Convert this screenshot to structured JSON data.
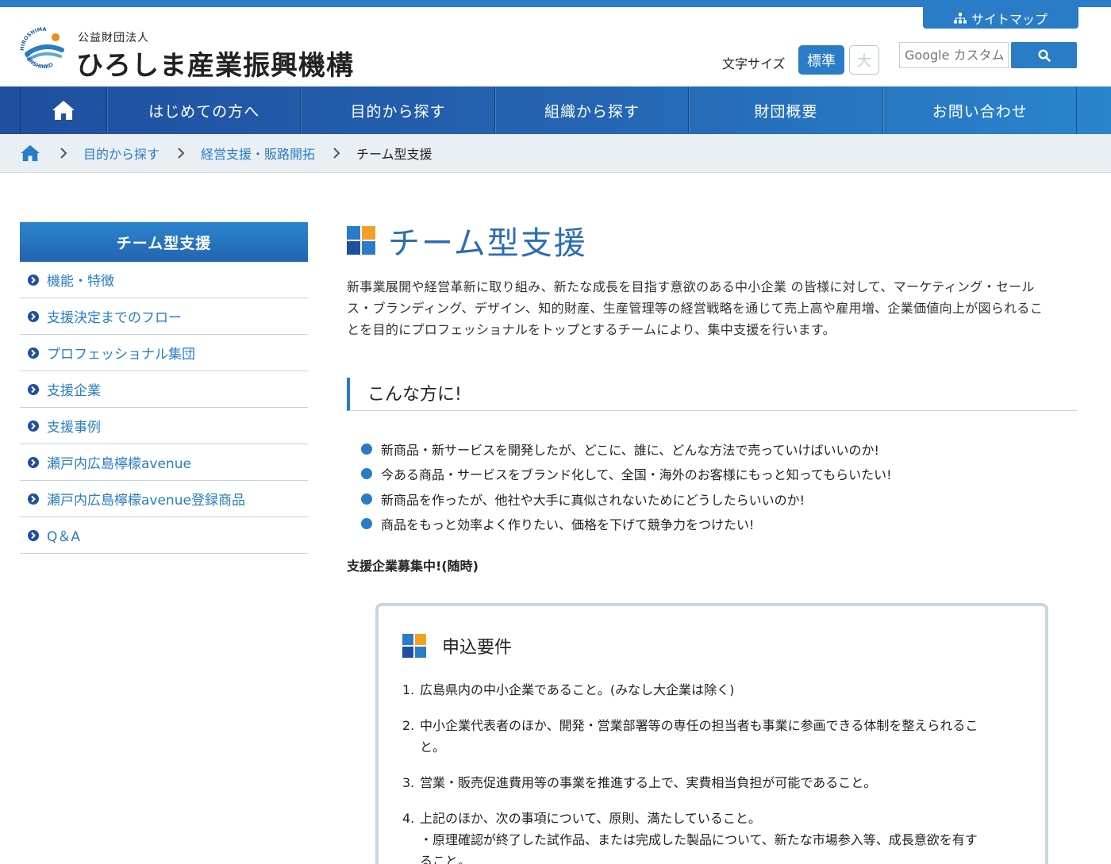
{
  "header": {
    "org_type": "公益財団法人",
    "org_name": "ひろしま産業振興機構",
    "logo_ring_text_top": "HIROSHIMA",
    "logo_ring_text_bottom": "SANSHINKO",
    "sitemap_label": "サイトマップ",
    "font_size_label": "文字サイズ",
    "font_size_standard": "標準",
    "font_size_large": "大",
    "search_placeholder": "Google カスタム検索"
  },
  "nav": {
    "items": [
      {
        "label": "はじめての方へ"
      },
      {
        "label": "目的から探す"
      },
      {
        "label": "組織から探す"
      },
      {
        "label": "財団概要"
      },
      {
        "label": "お問い合わせ"
      }
    ]
  },
  "breadcrumb": {
    "items": [
      "目的から探す",
      "経営支援・販路開拓"
    ],
    "current": "チーム型支援"
  },
  "sidebar": {
    "title": "チーム型支援",
    "items": [
      {
        "label": "機能・特徴"
      },
      {
        "label": "支援決定までのフロー"
      },
      {
        "label": "プロフェッショナル集団"
      },
      {
        "label": "支援企業"
      },
      {
        "label": "支援事例"
      },
      {
        "label": "瀬戸内広島檸檬avenue"
      },
      {
        "label": "瀬戸内広島檸檬avenue登録商品"
      },
      {
        "label": "Q＆A"
      }
    ]
  },
  "main": {
    "title": "チーム型支援",
    "intro_lines": [
      "新事業展開や経営革新に取り組み、新たな成長を目指す意欲のある中小企業 の皆様に対して、マーケティング・セール",
      "ス・ブランディング、デザイン、知的財産、生産管理等の経営戦略を通じて売上高や雇用増、企業価値向上が図られるこ",
      "とを目的にプロフェッショナルをトップとするチームにより、集中支援を行います。"
    ],
    "section_heading": "こんな方に!",
    "bullets": [
      "新商品・新サービスを開発したが、どこに、誰に、どんな方法で売っていけばいいのか!",
      "今ある商品・サービスをブランド化して、全国・海外のお客様にもっと知ってもらいたい!",
      "新商品を作ったが、他社や大手に真似されないためにどうしたらいいのか!",
      "商品をもっと効率よく作りたい、価格を下げて競争力をつけたい!"
    ],
    "recruit_text": "支援企業募集中!(随時)",
    "requirements": {
      "title": "申込要件",
      "items": [
        {
          "num": "1.",
          "lines": [
            "広島県内の中小企業であること。(みなし大企業は除く)"
          ]
        },
        {
          "num": "2.",
          "lines": [
            "中小企業代表者のほか、開発・営業部署等の専任の担当者も事業に参画できる体制を整えられるこ",
            "と。"
          ]
        },
        {
          "num": "3.",
          "lines": [
            "営業・販売促進費用等の事業を推進する上で、実費相当負担が可能であること。"
          ]
        },
        {
          "num": "4.",
          "lines": [
            "上記のほか、次の事項について、原則、満たしていること。",
            "・原理確認が終了した試作品、または完成した製品について、新たな市場参入等、成長意欲を有す",
            "ること。"
          ]
        }
      ]
    }
  },
  "colors": {
    "accent": "#2a7cc7",
    "nav_dark": "#1f4f9e",
    "title_blue": "#2a6db5",
    "breadcrumb_bg": "#e9eff3"
  }
}
